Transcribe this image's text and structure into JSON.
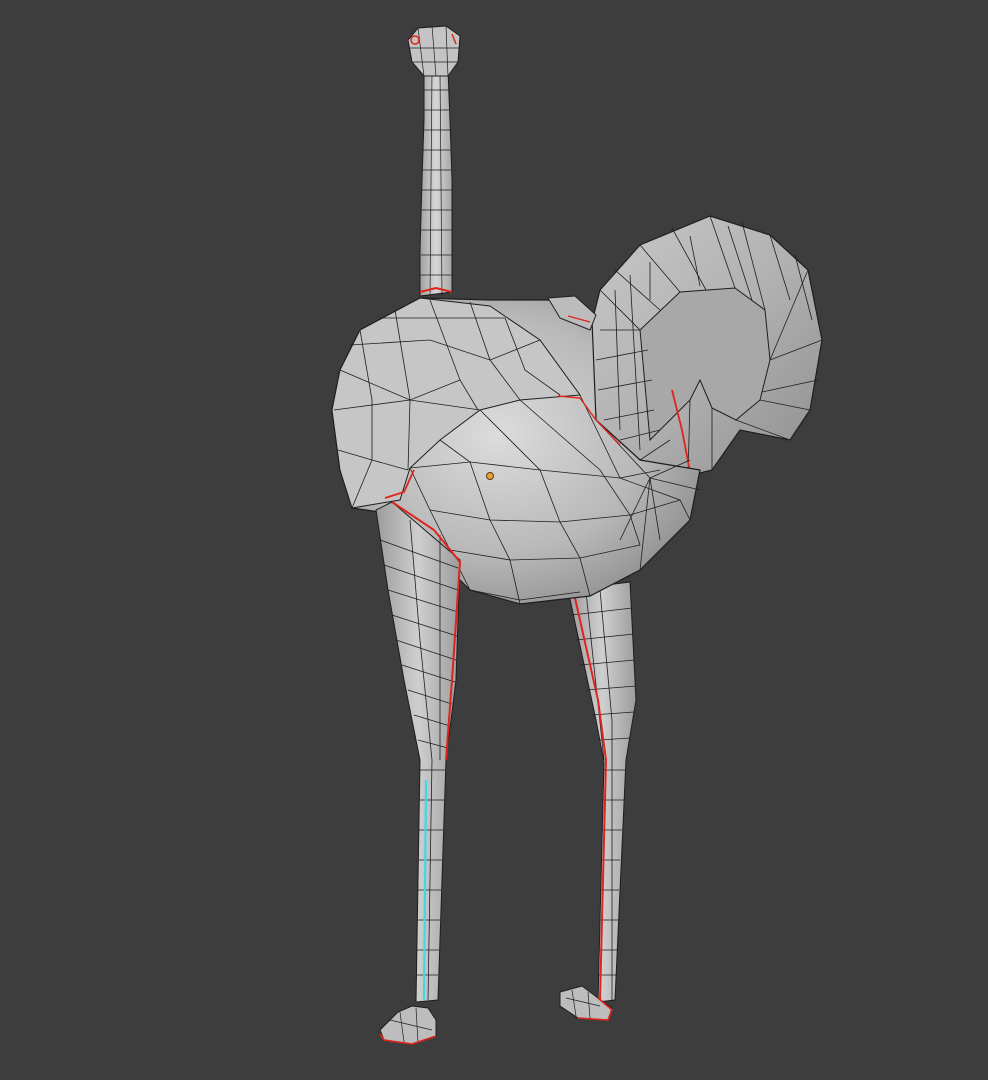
{
  "viewport": {
    "background": "#3d3d3d",
    "mode": "edit-mode-wireframe",
    "object": "ostrich-mesh"
  },
  "colors": {
    "mesh_fill": "#b4b4b4",
    "mesh_light": "#d2d2d2",
    "mesh_dark": "#8e8e8e",
    "wire": "#1e1e1e",
    "seam": "#e0241b",
    "selected_edge": "#3fd9e6",
    "origin": "#f0a030"
  }
}
